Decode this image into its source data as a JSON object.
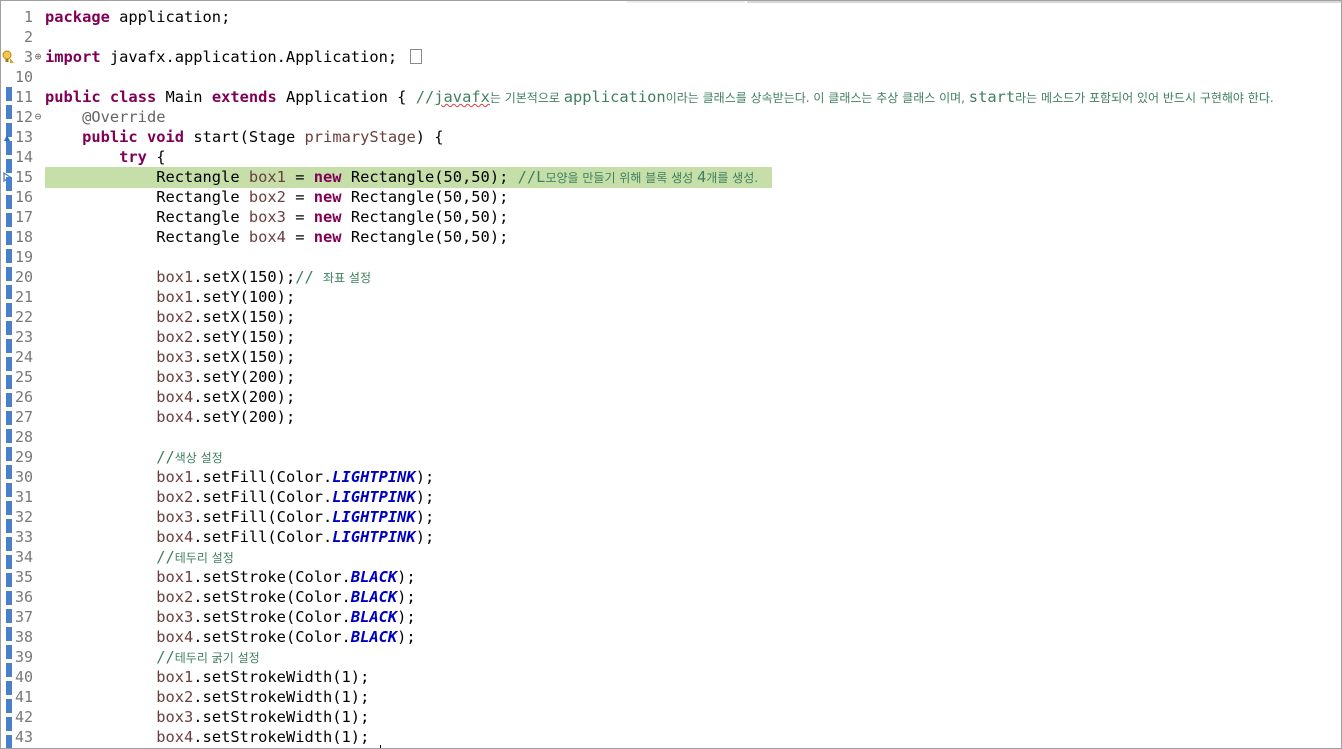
{
  "editor": {
    "lines": [
      {
        "n": "1",
        "parts": [
          {
            "t": "package",
            "c": "kw"
          },
          {
            "t": " application;",
            "c": ""
          }
        ]
      },
      {
        "n": "2",
        "parts": []
      },
      {
        "n": "3",
        "fold": "⊕",
        "marker": "warning",
        "collapsed": true,
        "parts": [
          {
            "t": "import",
            "c": "kw"
          },
          {
            "t": " javafx.application.Application;",
            "c": ""
          }
        ]
      },
      {
        "n": "10",
        "parts": []
      },
      {
        "n": "11",
        "parts": [
          {
            "t": "public",
            "c": "kw"
          },
          {
            "t": " ",
            "c": ""
          },
          {
            "t": "class",
            "c": "kw"
          },
          {
            "t": " Main ",
            "c": ""
          },
          {
            "t": "extends",
            "c": "kw"
          },
          {
            "t": " Application { ",
            "c": ""
          },
          {
            "t": "//",
            "c": "cm"
          },
          {
            "t": "javafx",
            "c": "cm squig"
          },
          {
            "t": "는 기본적으로 ",
            "c": "cm ko"
          },
          {
            "t": "application",
            "c": "cm"
          },
          {
            "t": "이라는 클래스를 상속받는다. 이 클래스는 추상 클래스 이며, ",
            "c": "cm ko"
          },
          {
            "t": "start",
            "c": "cm"
          },
          {
            "t": "라는 메소드가 포함되어 있어 반드시 구현해야 한다.",
            "c": "cm ko"
          }
        ]
      },
      {
        "n": "12",
        "fold": "⊖",
        "parts": [
          {
            "t": "    ",
            "c": ""
          },
          {
            "t": "@Override",
            "c": "an"
          }
        ]
      },
      {
        "n": "13",
        "marker": "override",
        "parts": [
          {
            "t": "    ",
            "c": ""
          },
          {
            "t": "public",
            "c": "kw"
          },
          {
            "t": " ",
            "c": ""
          },
          {
            "t": "void",
            "c": "kw"
          },
          {
            "t": " start(Stage ",
            "c": ""
          },
          {
            "t": "primaryStage",
            "c": "var"
          },
          {
            "t": ") {",
            "c": ""
          }
        ]
      },
      {
        "n": "14",
        "parts": [
          {
            "t": "        ",
            "c": ""
          },
          {
            "t": "try",
            "c": "kw"
          },
          {
            "t": " {",
            "c": ""
          }
        ]
      },
      {
        "n": "15",
        "highlight": true,
        "marker": "bookmark",
        "parts": [
          {
            "t": "            Rectangle ",
            "c": ""
          },
          {
            "t": "box1",
            "c": "var"
          },
          {
            "t": " = ",
            "c": ""
          },
          {
            "t": "new",
            "c": "kw"
          },
          {
            "t": " Rectangle(50,50); ",
            "c": ""
          },
          {
            "t": "//L",
            "c": "cm"
          },
          {
            "t": "모양을 만들기 위해 블록 생성 ",
            "c": "cm ko"
          },
          {
            "t": "4",
            "c": "cm"
          },
          {
            "t": "개를 생성.",
            "c": "cm ko"
          }
        ]
      },
      {
        "n": "16",
        "parts": [
          {
            "t": "            Rectangle ",
            "c": ""
          },
          {
            "t": "box2",
            "c": "var"
          },
          {
            "t": " = ",
            "c": ""
          },
          {
            "t": "new",
            "c": "kw"
          },
          {
            "t": " Rectangle(50,50);",
            "c": ""
          }
        ]
      },
      {
        "n": "17",
        "parts": [
          {
            "t": "            Rectangle ",
            "c": ""
          },
          {
            "t": "box3",
            "c": "var"
          },
          {
            "t": " = ",
            "c": ""
          },
          {
            "t": "new",
            "c": "kw"
          },
          {
            "t": " Rectangle(50,50);",
            "c": ""
          }
        ]
      },
      {
        "n": "18",
        "parts": [
          {
            "t": "            Rectangle ",
            "c": ""
          },
          {
            "t": "box4",
            "c": "var"
          },
          {
            "t": " = ",
            "c": ""
          },
          {
            "t": "new",
            "c": "kw"
          },
          {
            "t": " Rectangle(50,50);",
            "c": ""
          }
        ]
      },
      {
        "n": "19",
        "parts": []
      },
      {
        "n": "20",
        "parts": [
          {
            "t": "            ",
            "c": ""
          },
          {
            "t": "box1",
            "c": "var"
          },
          {
            "t": ".setX(150);",
            "c": ""
          },
          {
            "t": "// ",
            "c": "cm"
          },
          {
            "t": "좌표 설정",
            "c": "cm ko"
          }
        ]
      },
      {
        "n": "21",
        "parts": [
          {
            "t": "            ",
            "c": ""
          },
          {
            "t": "box1",
            "c": "var"
          },
          {
            "t": ".setY(100);",
            "c": ""
          }
        ]
      },
      {
        "n": "22",
        "parts": [
          {
            "t": "            ",
            "c": ""
          },
          {
            "t": "box2",
            "c": "var"
          },
          {
            "t": ".setX(150);",
            "c": ""
          }
        ]
      },
      {
        "n": "23",
        "parts": [
          {
            "t": "            ",
            "c": ""
          },
          {
            "t": "box2",
            "c": "var"
          },
          {
            "t": ".setY(150);",
            "c": ""
          }
        ]
      },
      {
        "n": "24",
        "parts": [
          {
            "t": "            ",
            "c": ""
          },
          {
            "t": "box3",
            "c": "var"
          },
          {
            "t": ".setX(150);",
            "c": ""
          }
        ]
      },
      {
        "n": "25",
        "parts": [
          {
            "t": "            ",
            "c": ""
          },
          {
            "t": "box3",
            "c": "var"
          },
          {
            "t": ".setY(200);",
            "c": ""
          }
        ]
      },
      {
        "n": "26",
        "parts": [
          {
            "t": "            ",
            "c": ""
          },
          {
            "t": "box4",
            "c": "var"
          },
          {
            "t": ".setX(200);",
            "c": ""
          }
        ]
      },
      {
        "n": "27",
        "parts": [
          {
            "t": "            ",
            "c": ""
          },
          {
            "t": "box4",
            "c": "var"
          },
          {
            "t": ".setY(200);",
            "c": ""
          }
        ]
      },
      {
        "n": "28",
        "parts": []
      },
      {
        "n": "29",
        "parts": [
          {
            "t": "            ",
            "c": ""
          },
          {
            "t": "//",
            "c": "cm"
          },
          {
            "t": "색상 설정",
            "c": "cm ko"
          }
        ]
      },
      {
        "n": "30",
        "parts": [
          {
            "t": "            ",
            "c": ""
          },
          {
            "t": "box1",
            "c": "var"
          },
          {
            "t": ".setFill(Color.",
            "c": ""
          },
          {
            "t": "LIGHTPINK",
            "c": "sf"
          },
          {
            "t": ");",
            "c": ""
          }
        ]
      },
      {
        "n": "31",
        "parts": [
          {
            "t": "            ",
            "c": ""
          },
          {
            "t": "box2",
            "c": "var"
          },
          {
            "t": ".setFill(Color.",
            "c": ""
          },
          {
            "t": "LIGHTPINK",
            "c": "sf"
          },
          {
            "t": ");",
            "c": ""
          }
        ]
      },
      {
        "n": "32",
        "parts": [
          {
            "t": "            ",
            "c": ""
          },
          {
            "t": "box3",
            "c": "var"
          },
          {
            "t": ".setFill(Color.",
            "c": ""
          },
          {
            "t": "LIGHTPINK",
            "c": "sf"
          },
          {
            "t": ");",
            "c": ""
          }
        ]
      },
      {
        "n": "33",
        "parts": [
          {
            "t": "            ",
            "c": ""
          },
          {
            "t": "box4",
            "c": "var"
          },
          {
            "t": ".setFill(Color.",
            "c": ""
          },
          {
            "t": "LIGHTPINK",
            "c": "sf"
          },
          {
            "t": ");",
            "c": ""
          }
        ]
      },
      {
        "n": "34",
        "parts": [
          {
            "t": "            ",
            "c": ""
          },
          {
            "t": "//",
            "c": "cm"
          },
          {
            "t": "테두리 설정",
            "c": "cm ko"
          }
        ]
      },
      {
        "n": "35",
        "parts": [
          {
            "t": "            ",
            "c": ""
          },
          {
            "t": "box1",
            "c": "var"
          },
          {
            "t": ".setStroke(Color.",
            "c": ""
          },
          {
            "t": "BLACK",
            "c": "sf"
          },
          {
            "t": ");",
            "c": ""
          }
        ]
      },
      {
        "n": "36",
        "parts": [
          {
            "t": "            ",
            "c": ""
          },
          {
            "t": "box2",
            "c": "var"
          },
          {
            "t": ".setStroke(Color.",
            "c": ""
          },
          {
            "t": "BLACK",
            "c": "sf"
          },
          {
            "t": ");",
            "c": ""
          }
        ]
      },
      {
        "n": "37",
        "parts": [
          {
            "t": "            ",
            "c": ""
          },
          {
            "t": "box3",
            "c": "var"
          },
          {
            "t": ".setStroke(Color.",
            "c": ""
          },
          {
            "t": "BLACK",
            "c": "sf"
          },
          {
            "t": ");",
            "c": ""
          }
        ]
      },
      {
        "n": "38",
        "parts": [
          {
            "t": "            ",
            "c": ""
          },
          {
            "t": "box4",
            "c": "var"
          },
          {
            "t": ".setStroke(Color.",
            "c": ""
          },
          {
            "t": "BLACK",
            "c": "sf"
          },
          {
            "t": ");",
            "c": ""
          }
        ]
      },
      {
        "n": "39",
        "parts": [
          {
            "t": "            ",
            "c": ""
          },
          {
            "t": "//",
            "c": "cm"
          },
          {
            "t": "테두리 굵기 설정",
            "c": "cm ko"
          }
        ]
      },
      {
        "n": "40",
        "parts": [
          {
            "t": "            ",
            "c": ""
          },
          {
            "t": "box1",
            "c": "var"
          },
          {
            "t": ".setStrokeWidth(1);",
            "c": ""
          }
        ]
      },
      {
        "n": "41",
        "parts": [
          {
            "t": "            ",
            "c": ""
          },
          {
            "t": "box2",
            "c": "var"
          },
          {
            "t": ".setStrokeWidth(1);",
            "c": ""
          }
        ]
      },
      {
        "n": "42",
        "parts": [
          {
            "t": "            ",
            "c": ""
          },
          {
            "t": "box3",
            "c": "var"
          },
          {
            "t": ".setStrokeWidth(1);",
            "c": ""
          }
        ]
      },
      {
        "n": "43",
        "parts": [
          {
            "t": "            ",
            "c": ""
          },
          {
            "t": "box4",
            "c": "var"
          },
          {
            "t": ".setStrokeWidth(1);",
            "c": ""
          }
        ]
      }
    ]
  },
  "colors": {
    "keyword": "#7f0055",
    "comment": "#3f7f5f",
    "annotation": "#646464",
    "local_variable": "#6a3e3e",
    "static_field": "#0000c0",
    "current_line_highlight": "#c6dfa9",
    "line_number": "#787878",
    "ruler_marker": "#4a7fcc"
  },
  "icons": {
    "warning_marker": "lightbulb-warning-icon",
    "override_marker": "override-triangle-icon",
    "bookmark_marker": "current-line-arrow-icon",
    "collapsed_import": "collapsed-block-icon"
  }
}
